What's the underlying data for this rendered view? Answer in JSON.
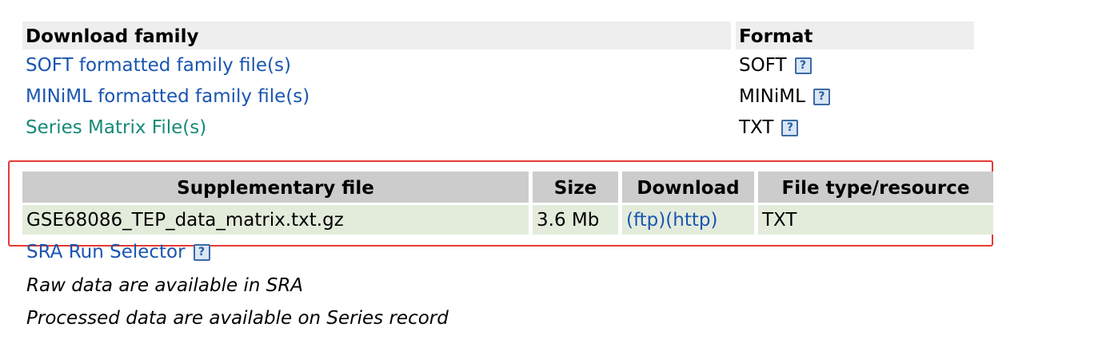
{
  "family": {
    "header": {
      "col1": "Download family",
      "col2": "Format"
    },
    "rows": [
      {
        "label": "SOFT formatted family file(s)",
        "format": "SOFT",
        "help": "?"
      },
      {
        "label": "MINiML formatted family file(s)",
        "format": "MINiML",
        "help": "?"
      },
      {
        "label": "Series Matrix File(s)",
        "format": "TXT",
        "help": "?"
      }
    ]
  },
  "supplementary": {
    "headers": [
      "Supplementary file",
      "Size",
      "Download",
      "File type/resource"
    ],
    "rows": [
      {
        "file": "GSE68086_TEP_data_matrix.txt.gz",
        "size": "3.6 Mb",
        "ftp": "(ftp)",
        "http": "(http)",
        "type": "TXT"
      }
    ]
  },
  "sra": {
    "label": "SRA Run Selector",
    "help": "?"
  },
  "notes": [
    "Raw data are available in SRA",
    "Processed data are available on Series record"
  ],
  "colors": {
    "link": "#1a55b0",
    "visited_link": "#178a78",
    "highlight": "#e53935"
  }
}
